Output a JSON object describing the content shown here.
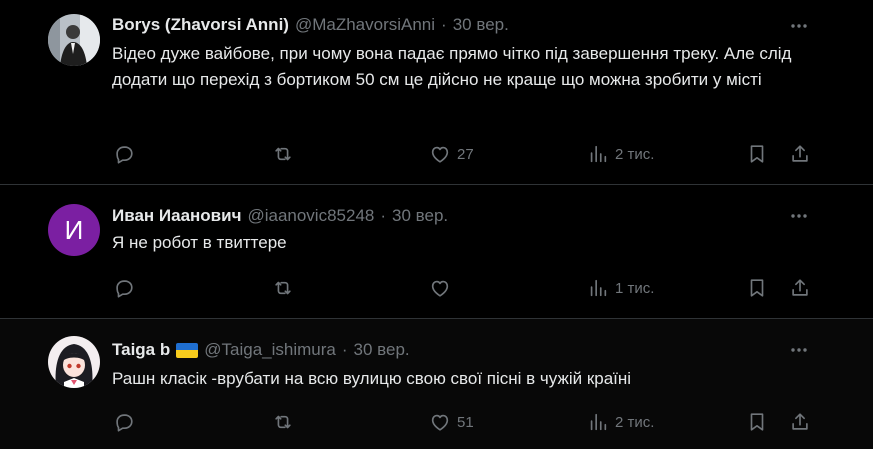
{
  "colors": {
    "background": "#000000",
    "text": "#e7e9ea",
    "muted": "#71767b",
    "divider": "#2f3336",
    "avatar_purple": "#7b1fa2"
  },
  "tweets": [
    {
      "name": "Borys (Zhavorsi Anni)",
      "handle": "@MaZhavorsiAnni",
      "dot": "·",
      "time": "30 вер.",
      "text": "Відео дуже вайбове, при чому вона падає прямо чітко під завершення треку. Але слід додати що перехід з бортиком 50 см це дійсно не краще що можна зробити у місті",
      "avatar": "photo-man-suit",
      "replies": "",
      "retweets": "",
      "likes": "27",
      "views": "2 тис."
    },
    {
      "name": "Иван Иаанович",
      "handle": "@iaanovic85248",
      "dot": "·",
      "time": "30 вер.",
      "text": "Я не робот в твиттере",
      "avatar_letter": "И",
      "replies": "",
      "retweets": "",
      "likes": "",
      "views": "1 тис."
    },
    {
      "name": "Taiga b",
      "flag": "ukraine-flag",
      "handle": "@Taiga_ishimura",
      "dot": "·",
      "time": "30 вер.",
      "text": "Рашн класік -врубати на всю вулицю свою свої пісні в чужій країні",
      "avatar": "anime-girl",
      "replies": "",
      "retweets": "",
      "likes": "51",
      "views": "2 тис."
    }
  ]
}
